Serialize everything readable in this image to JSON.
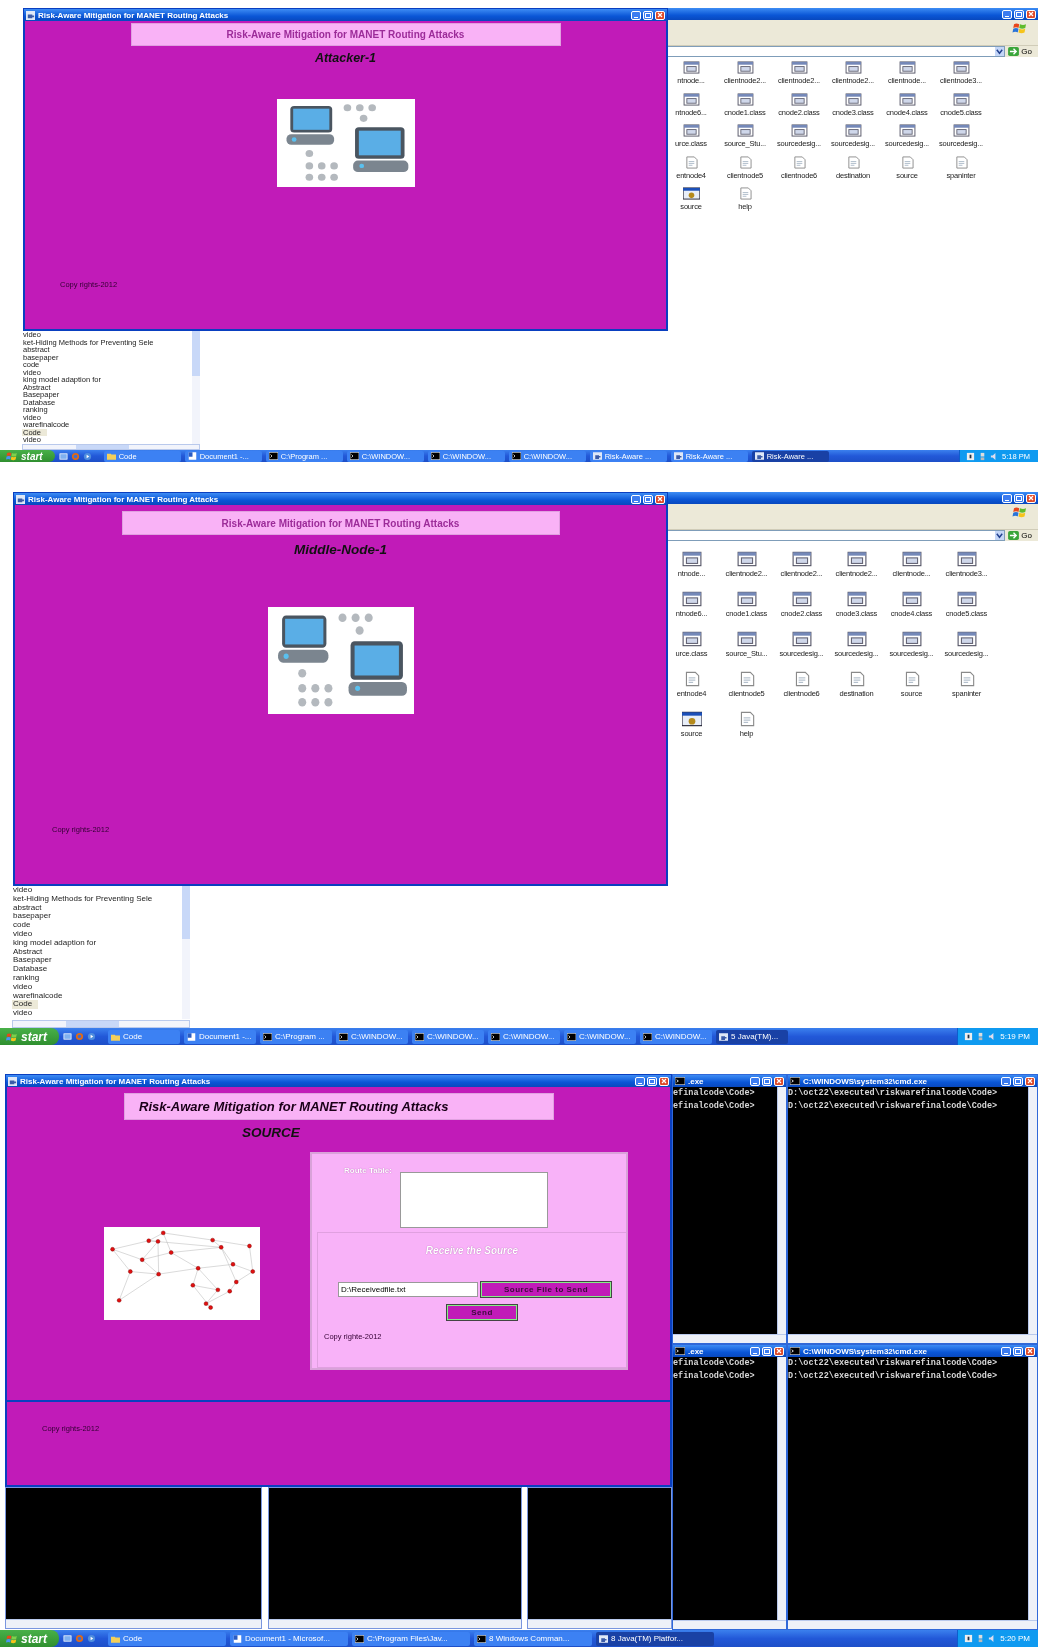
{
  "screens": [
    {
      "kind": "node",
      "explorer": {
        "go": "Go",
        "files": [
          {
            "name": "ntnode...",
            "kind": "class"
          },
          {
            "name": "clientnode2...",
            "kind": "class"
          },
          {
            "name": "clientnode2...",
            "kind": "class"
          },
          {
            "name": "clientnode2...",
            "kind": "class"
          },
          {
            "name": "clientnode...",
            "kind": "class"
          },
          {
            "name": "clientnode3...",
            "kind": "class"
          },
          {
            "name": "ntnode6...",
            "kind": "class"
          },
          {
            "name": "cnode1.class",
            "kind": "class"
          },
          {
            "name": "cnode2.class",
            "kind": "class"
          },
          {
            "name": "cnode3.class",
            "kind": "class"
          },
          {
            "name": "cnode4.class",
            "kind": "class"
          },
          {
            "name": "cnode5.class",
            "kind": "class"
          },
          {
            "name": "urce.class",
            "kind": "class"
          },
          {
            "name": "source_Stu...",
            "kind": "class"
          },
          {
            "name": "sourcedesig...",
            "kind": "class"
          },
          {
            "name": "sourcedesig...",
            "kind": "class"
          },
          {
            "name": "sourcedesig...",
            "kind": "class"
          },
          {
            "name": "sourcedesig...",
            "kind": "class"
          },
          {
            "name": "entnode4",
            "kind": "plain"
          },
          {
            "name": "clientnode5",
            "kind": "plain"
          },
          {
            "name": "clientnode6",
            "kind": "plain"
          },
          {
            "name": "destination",
            "kind": "plain"
          },
          {
            "name": "source",
            "kind": "plain"
          },
          {
            "name": "spaninter",
            "kind": "plain"
          },
          {
            "name": "source",
            "kind": "app"
          },
          {
            "name": "help",
            "kind": "plain"
          }
        ]
      },
      "tree": [
        {
          "label": "video",
          "selected": false
        },
        {
          "label": "ket-Hiding Methods for Preventing Sele",
          "selected": false
        },
        {
          "label": "abstract",
          "selected": false
        },
        {
          "label": "basepaper",
          "selected": false
        },
        {
          "label": "code",
          "selected": false
        },
        {
          "label": "video",
          "selected": false
        },
        {
          "label": "king model adaption for",
          "selected": false
        },
        {
          "label": "Abstract",
          "selected": false
        },
        {
          "label": "Basepaper",
          "selected": false
        },
        {
          "label": "Database",
          "selected": false
        },
        {
          "label": "ranking",
          "selected": false
        },
        {
          "label": "video",
          "selected": false
        },
        {
          "label": "warefinalcode",
          "selected": false
        },
        {
          "label": "Code",
          "selected": true
        },
        {
          "label": "video",
          "selected": false
        }
      ],
      "window": {
        "title": "Risk-Aware Mitigation for MANET Routing Attacks",
        "banner": "Risk-Aware Mitigation for MANET Routing Attacks",
        "role": "Attacker-1",
        "copyright": "Copy rights-2012"
      },
      "taskbar": {
        "start": "start",
        "items": [
          {
            "label": "Code",
            "kind": "folder",
            "selected": false
          },
          {
            "label": "Document1 -...",
            "kind": "word",
            "selected": false
          },
          {
            "label": "C:\\Program ...",
            "kind": "cmd",
            "selected": false
          },
          {
            "label": "C:\\WINDOW...",
            "kind": "cmd",
            "selected": false
          },
          {
            "label": "C:\\WINDOW...",
            "kind": "cmd",
            "selected": false
          },
          {
            "label": "C:\\WINDOW...",
            "kind": "cmd",
            "selected": false
          },
          {
            "label": "Risk-Aware ...",
            "kind": "java",
            "selected": false
          },
          {
            "label": "Risk-Aware ...",
            "kind": "java",
            "selected": false
          },
          {
            "label": "Risk-Aware ...",
            "kind": "java",
            "selected": true
          }
        ],
        "clock": "5:18 PM"
      }
    },
    {
      "kind": "node",
      "explorer": {
        "go": "Go",
        "files": [
          {
            "name": "ntnode...",
            "kind": "class"
          },
          {
            "name": "clientnode2...",
            "kind": "class"
          },
          {
            "name": "clientnode2...",
            "kind": "class"
          },
          {
            "name": "clientnode2...",
            "kind": "class"
          },
          {
            "name": "clientnode...",
            "kind": "class"
          },
          {
            "name": "clientnode3...",
            "kind": "class"
          },
          {
            "name": "ntnode6...",
            "kind": "class"
          },
          {
            "name": "cnode1.class",
            "kind": "class"
          },
          {
            "name": "cnode2.class",
            "kind": "class"
          },
          {
            "name": "cnode3.class",
            "kind": "class"
          },
          {
            "name": "cnode4.class",
            "kind": "class"
          },
          {
            "name": "cnode5.class",
            "kind": "class"
          },
          {
            "name": "urce.class",
            "kind": "class"
          },
          {
            "name": "source_Stu...",
            "kind": "class"
          },
          {
            "name": "sourcedesig...",
            "kind": "class"
          },
          {
            "name": "sourcedesig...",
            "kind": "class"
          },
          {
            "name": "sourcedesig...",
            "kind": "class"
          },
          {
            "name": "sourcedesig...",
            "kind": "class"
          },
          {
            "name": "entnode4",
            "kind": "plain"
          },
          {
            "name": "clientnode5",
            "kind": "plain"
          },
          {
            "name": "clientnode6",
            "kind": "plain"
          },
          {
            "name": "destination",
            "kind": "plain"
          },
          {
            "name": "source",
            "kind": "plain"
          },
          {
            "name": "spaninter",
            "kind": "plain"
          },
          {
            "name": "source",
            "kind": "app"
          },
          {
            "name": "help",
            "kind": "plain"
          }
        ]
      },
      "tree": [
        {
          "label": "video",
          "selected": false
        },
        {
          "label": "ket-Hiding Methods for Preventing Sele",
          "selected": false
        },
        {
          "label": "abstract",
          "selected": false
        },
        {
          "label": "basepaper",
          "selected": false
        },
        {
          "label": "code",
          "selected": false
        },
        {
          "label": "video",
          "selected": false
        },
        {
          "label": "king model adaption for",
          "selected": false
        },
        {
          "label": "Abstract",
          "selected": false
        },
        {
          "label": "Basepaper",
          "selected": false
        },
        {
          "label": "Database",
          "selected": false
        },
        {
          "label": "ranking",
          "selected": false
        },
        {
          "label": "video",
          "selected": false
        },
        {
          "label": "warefinalcode",
          "selected": false
        },
        {
          "label": "Code",
          "selected": true
        },
        {
          "label": "video",
          "selected": false
        }
      ],
      "window": {
        "title": "Risk-Aware Mitigation for MANET Routing Attacks",
        "banner": "Risk-Aware Mitigation for MANET Routing Attacks",
        "role": "Middle-Node-1",
        "copyright": "Copy rights-2012"
      },
      "taskbar": {
        "start": "start",
        "items": [
          {
            "label": "Code",
            "kind": "folder",
            "selected": false
          },
          {
            "label": "Document1 -...",
            "kind": "word",
            "selected": false
          },
          {
            "label": "C:\\Program ...",
            "kind": "cmd",
            "selected": false
          },
          {
            "label": "C:\\WINDOW...",
            "kind": "cmd",
            "selected": false
          },
          {
            "label": "C:\\WINDOW...",
            "kind": "cmd",
            "selected": false
          },
          {
            "label": "C:\\WINDOW...",
            "kind": "cmd",
            "selected": false
          },
          {
            "label": "C:\\WINDOW...",
            "kind": "cmd",
            "selected": false
          },
          {
            "label": "C:\\WINDOW...",
            "kind": "cmd",
            "selected": false
          },
          {
            "label": "5 Java(TM)...",
            "kind": "java",
            "selected": true
          }
        ],
        "clock": "5:19 PM"
      }
    },
    {
      "kind": "source",
      "window": {
        "title": "Risk-Aware Mitigation for MANET Routing Attacks",
        "banner": "Risk-Aware Mitigation for MANET Routing Attacks",
        "role": "SOURCE",
        "route_table_label": "Route Table:",
        "receive_heading": "Receive the Source",
        "file_field": {
          "value": "D:\\Receivedfile.txt"
        },
        "browse_button": "Source File to Send",
        "send_button": "Send",
        "panel_copyright": "Copy righte-2012"
      },
      "back_window": {
        "copyright": "Copy rights-2012"
      },
      "consoles": [
        {
          "title": ".exe",
          "lines": [
            "efinalcode\\Code>",
            "efinalcode\\Code>"
          ]
        },
        {
          "title": "C:\\WINDOWS\\system32\\cmd.exe",
          "lines": [
            "D:\\oct22\\executed\\riskwarefinalcode\\Code>",
            "D:\\oct22\\executed\\riskwarefinalcode\\Code>"
          ]
        },
        {
          "title": ".exe",
          "lines": [
            "efinalcode\\Code>",
            "efinalcode\\Code>"
          ]
        },
        {
          "title": "C:\\WINDOWS\\system32\\cmd.exe",
          "lines": [
            "D:\\oct22\\executed\\riskwarefinalcode\\Code>",
            "D:\\oct22\\executed\\riskwarefinalcode\\Code>"
          ]
        }
      ],
      "taskbar": {
        "start": "start",
        "items": [
          {
            "label": "Code",
            "kind": "folder",
            "selected": false
          },
          {
            "label": "Document1 - Microsof...",
            "kind": "word",
            "selected": false
          },
          {
            "label": "C:\\Program Files\\Jav...",
            "kind": "cmd",
            "selected": false
          },
          {
            "label": "8 Windows Comman...",
            "kind": "cmd",
            "selected": false
          },
          {
            "label": "8 Java(TM) Platfor...",
            "kind": "java",
            "selected": true
          }
        ],
        "clock": "5:20 PM"
      }
    }
  ]
}
